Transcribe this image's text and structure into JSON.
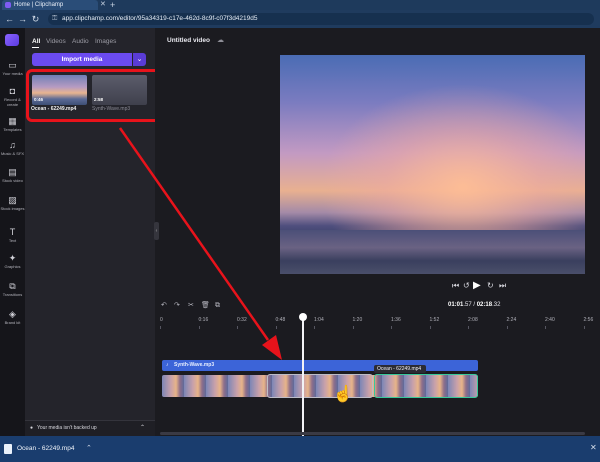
{
  "browser": {
    "tab_title": "Home | Clipchamp",
    "tab_close": "✕",
    "new_tab": "+",
    "url": "app.clipchamp.com/editor/95a34319-c17e-462d-8c9f-c07f3d4219d5",
    "nav": {
      "back": "←",
      "forward": "→",
      "reload": "↻"
    }
  },
  "rail": {
    "items": [
      {
        "icon": "▭",
        "label": "Your media"
      },
      {
        "icon": "◘",
        "label": "Record & create"
      },
      {
        "icon": "▦",
        "label": "Templates"
      },
      {
        "icon": "♫",
        "label": "Music & SFX"
      },
      {
        "icon": "▤",
        "label": "Stock video"
      },
      {
        "icon": "▨",
        "label": "Stock images"
      },
      {
        "icon": "T",
        "label": "Text"
      },
      {
        "icon": "✦",
        "label": "Graphics"
      },
      {
        "icon": "⧉",
        "label": "Transitions"
      },
      {
        "icon": "◈",
        "label": "Brand kit"
      }
    ]
  },
  "media_panel": {
    "tabs": [
      "All",
      "Videos",
      "Audio",
      "Images"
    ],
    "import_label": "Import media",
    "import_caret": "⌄",
    "items": [
      {
        "name": "Ocean - 62249.mp4",
        "duration": "0:46"
      },
      {
        "name": "Synth-Wave.mp3",
        "duration": "2:58"
      }
    ],
    "backup_text": "Your media isn't backed up",
    "backup_caret": "⌃"
  },
  "editor": {
    "title": "Untitled video",
    "collapse": "‹",
    "player": {
      "skip_back": "⏮",
      "rewind5": "↺",
      "play": "▶",
      "forward5": "↻",
      "skip_fwd": "⏭"
    },
    "tools": [
      "↶",
      "↷",
      "✂",
      "🗑",
      "⧉"
    ],
    "time_current": "01:01",
    "time_current_frac": ".57",
    "time_sep": " / ",
    "time_total": "02:18",
    "time_total_frac": ".32",
    "ruler": [
      "0",
      "0:16",
      "0:32",
      "0:48",
      "1:04",
      "1:20",
      "1:36",
      "1:52",
      "2:08",
      "2:24",
      "2:40",
      "2:56"
    ],
    "audio_track": "Synth-Wave.mp3",
    "clip_label": "Ocean - 62249.mp4"
  },
  "download": {
    "file": "Ocean - 62249.mp4",
    "caret": "⌃",
    "close": "✕"
  },
  "colors": {
    "accent": "#6b4bf0",
    "highlight": "#e8131b",
    "audio_track": "#3c64d8",
    "selected_clip": "#37c99a"
  }
}
